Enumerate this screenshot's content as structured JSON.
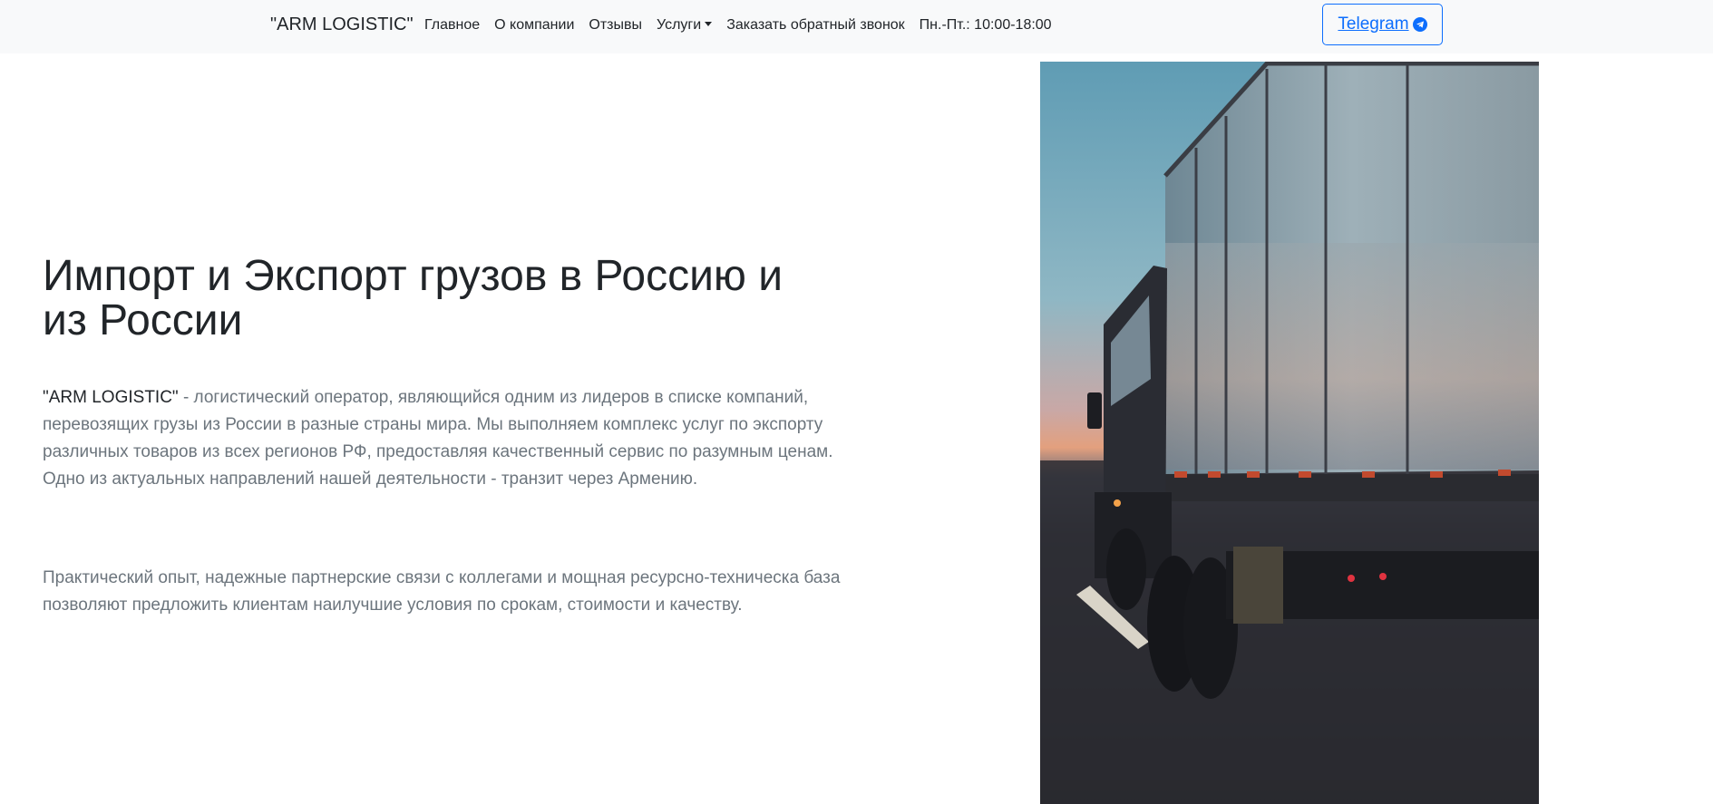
{
  "navbar": {
    "brand": "\"ARM LOGISTIC\"",
    "links": [
      "Главное",
      "О компании",
      "Отзывы",
      "Услуги",
      "Заказать обратный звонок"
    ],
    "hours": "Пн.-Пт.: 10:00-18:00",
    "telegram_label": "Telegram"
  },
  "hero": {
    "title": "Импорт и Экспорт грузов в Россию и из России",
    "p1_brand": "\"ARM LOGISTIC\"",
    "p1_rest": " - логистический оператор, являющийся одним из лидеров в списке компаний, перевозящих грузы из России в разные страны мира. Мы выполняем комплекс услуг по экспорту различных товаров из всех регионов РФ, предоставляя качественный сервис по разумным ценам. Одно из актуальных направлений нашей деятельности - транзит через Армению.",
    "p2": "Практический опыт, надежные партнерские связи с коллегами и мощная ресурсно-техническа база позволяют предложить клиентам наилучшие условия по срокам, стоимости и качеству."
  },
  "colors": {
    "accent": "#0d6efd",
    "navbar_bg": "#f8f9fa",
    "muted_text": "#6c757d"
  },
  "icons": {
    "telegram": "telegram-icon",
    "dropdown": "chevron-down-icon"
  }
}
